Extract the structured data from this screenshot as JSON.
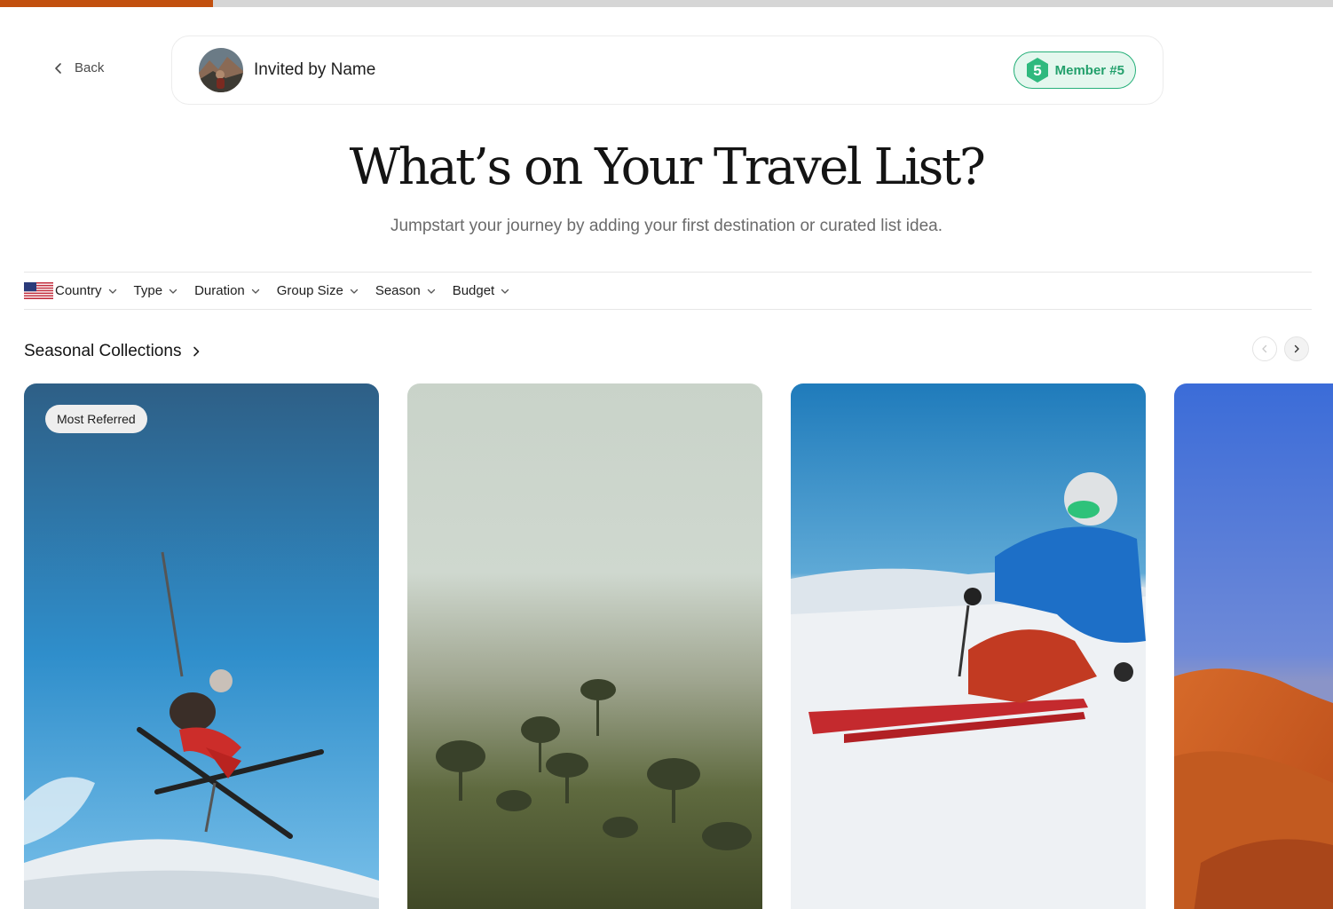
{
  "progress": {
    "fraction": 0.16,
    "fill_color": "#c2500f"
  },
  "header": {
    "back_label": "Back",
    "invite_text": "Invited by Name",
    "member_badge": {
      "number": "5",
      "label": "Member #5",
      "color": "#23a06c"
    }
  },
  "hero": {
    "title": "What’s on Your Travel List?",
    "subtitle": "Jumpstart your journey by adding your first destination or curated list idea."
  },
  "filters": {
    "country_flag": "us-flag-icon",
    "items": [
      {
        "label": "Country"
      },
      {
        "label": "Type"
      },
      {
        "label": "Duration"
      },
      {
        "label": "Group Size"
      },
      {
        "label": "Season"
      },
      {
        "label": "Budget"
      }
    ]
  },
  "section": {
    "title": "Seasonal Collections"
  },
  "cards": [
    {
      "badge": "Most Referred",
      "image": "ski-jump-photo"
    },
    {
      "badge": "",
      "image": "misty-forest-photo"
    },
    {
      "badge": "",
      "image": "skier-slope-photo"
    },
    {
      "badge": "",
      "image": "desert-dunes-photo"
    }
  ]
}
